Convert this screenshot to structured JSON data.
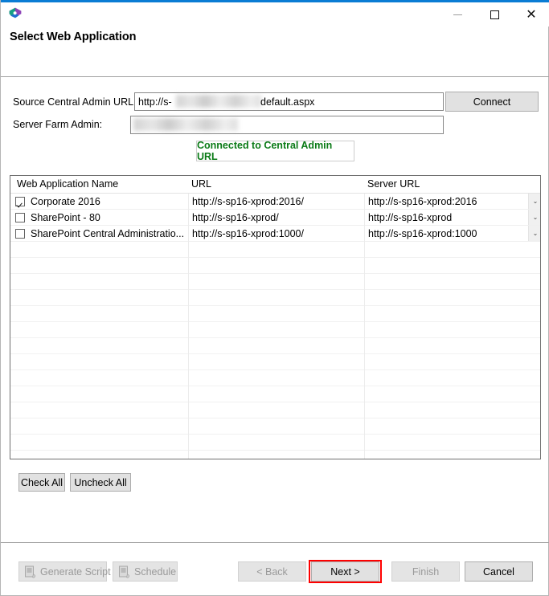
{
  "window": {
    "icon_name": "app-hexagon-logo-icon",
    "accent_color": "#0a7cd4",
    "minimize_label": "",
    "maximize_label": "",
    "close_label": "✕"
  },
  "header": {
    "title": "Select Web Application"
  },
  "form": {
    "source_url_label": "Source Central Admin URL:",
    "source_url_value_prefix": "http://s-",
    "source_url_value_suffix": "default.aspx",
    "source_url_redacted": true,
    "farm_admin_label": "Server Farm Admin:",
    "farm_admin_value": "",
    "farm_admin_redacted": true,
    "connect_label": "Connect",
    "status_text": "Connected to Central Admin URL",
    "status_color": "#0a7a16"
  },
  "grid": {
    "columns": [
      "Web Application Name",
      "URL",
      "Server URL"
    ],
    "rows": [
      {
        "checked": true,
        "name": "Corporate 2016",
        "url": "http://s-sp16-xprod:2016/",
        "server_url": "http://s-sp16-xprod:2016",
        "has_dropdown": true
      },
      {
        "checked": false,
        "name": "SharePoint - 80",
        "url": "http://s-sp16-xprod/",
        "server_url": "http://s-sp16-xprod",
        "has_dropdown": true
      },
      {
        "checked": false,
        "name": "SharePoint Central Administratio...",
        "url": "http://s-sp16-xprod:1000/",
        "server_url": "http://s-sp16-xprod:1000",
        "has_dropdown": true
      }
    ],
    "empty_row_count": 14,
    "dropdown_icon": "chevron-down-icon"
  },
  "selection_actions": {
    "check_all_label": "Check All",
    "uncheck_all_label": "Uncheck All"
  },
  "footer": {
    "generate_script_label": "Generate Script",
    "generate_script_enabled": false,
    "schedule_label": "Schedule",
    "schedule_enabled": false,
    "back_label": "< Back",
    "back_enabled": false,
    "next_label": "Next >",
    "next_enabled": true,
    "next_highlight_color": "#ff0000",
    "finish_label": "Finish",
    "finish_enabled": false,
    "cancel_label": "Cancel",
    "cancel_enabled": true,
    "script_icon": "script-document-icon"
  }
}
